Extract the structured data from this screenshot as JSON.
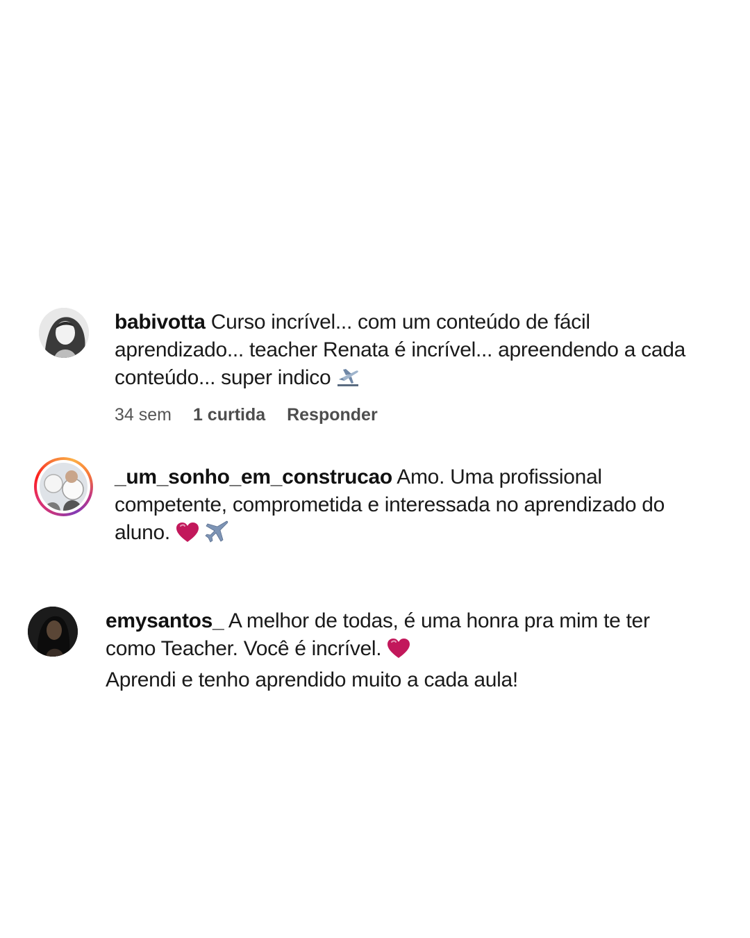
{
  "comments": [
    {
      "username": "babivotta",
      "text_line1": "Curso incrível... com um conteúdo de fácil",
      "text_line2": "aprendizado... teacher Renata é incrível... apreendendo a cada",
      "text_line3": "conteúdo... super indico",
      "emoji": "airplane-departure-icon",
      "time": "34 sem",
      "likes": "1 curtida",
      "reply": "Responder"
    },
    {
      "username": "_um_sonho_em_construcao",
      "text_line1": "Amo. Uma profissional",
      "text_line2": "competente, comprometida e interessada no aprendizado do",
      "text_line3": "aluno.",
      "emojis": [
        "heart-icon",
        "airplane-icon"
      ]
    },
    {
      "username": "emysantos_",
      "text_line1": "A melhor de todas, é uma honra pra mim te ter",
      "text_line2": "como Teacher. Você é incrível.",
      "text_line3": "Aprendi e tenho aprendido muito a cada aula!",
      "emoji": "heart-icon"
    }
  ],
  "colors": {
    "heart": "#c2185b",
    "story_ring_start": "#c13584",
    "story_ring_end": "#fcaf45"
  }
}
